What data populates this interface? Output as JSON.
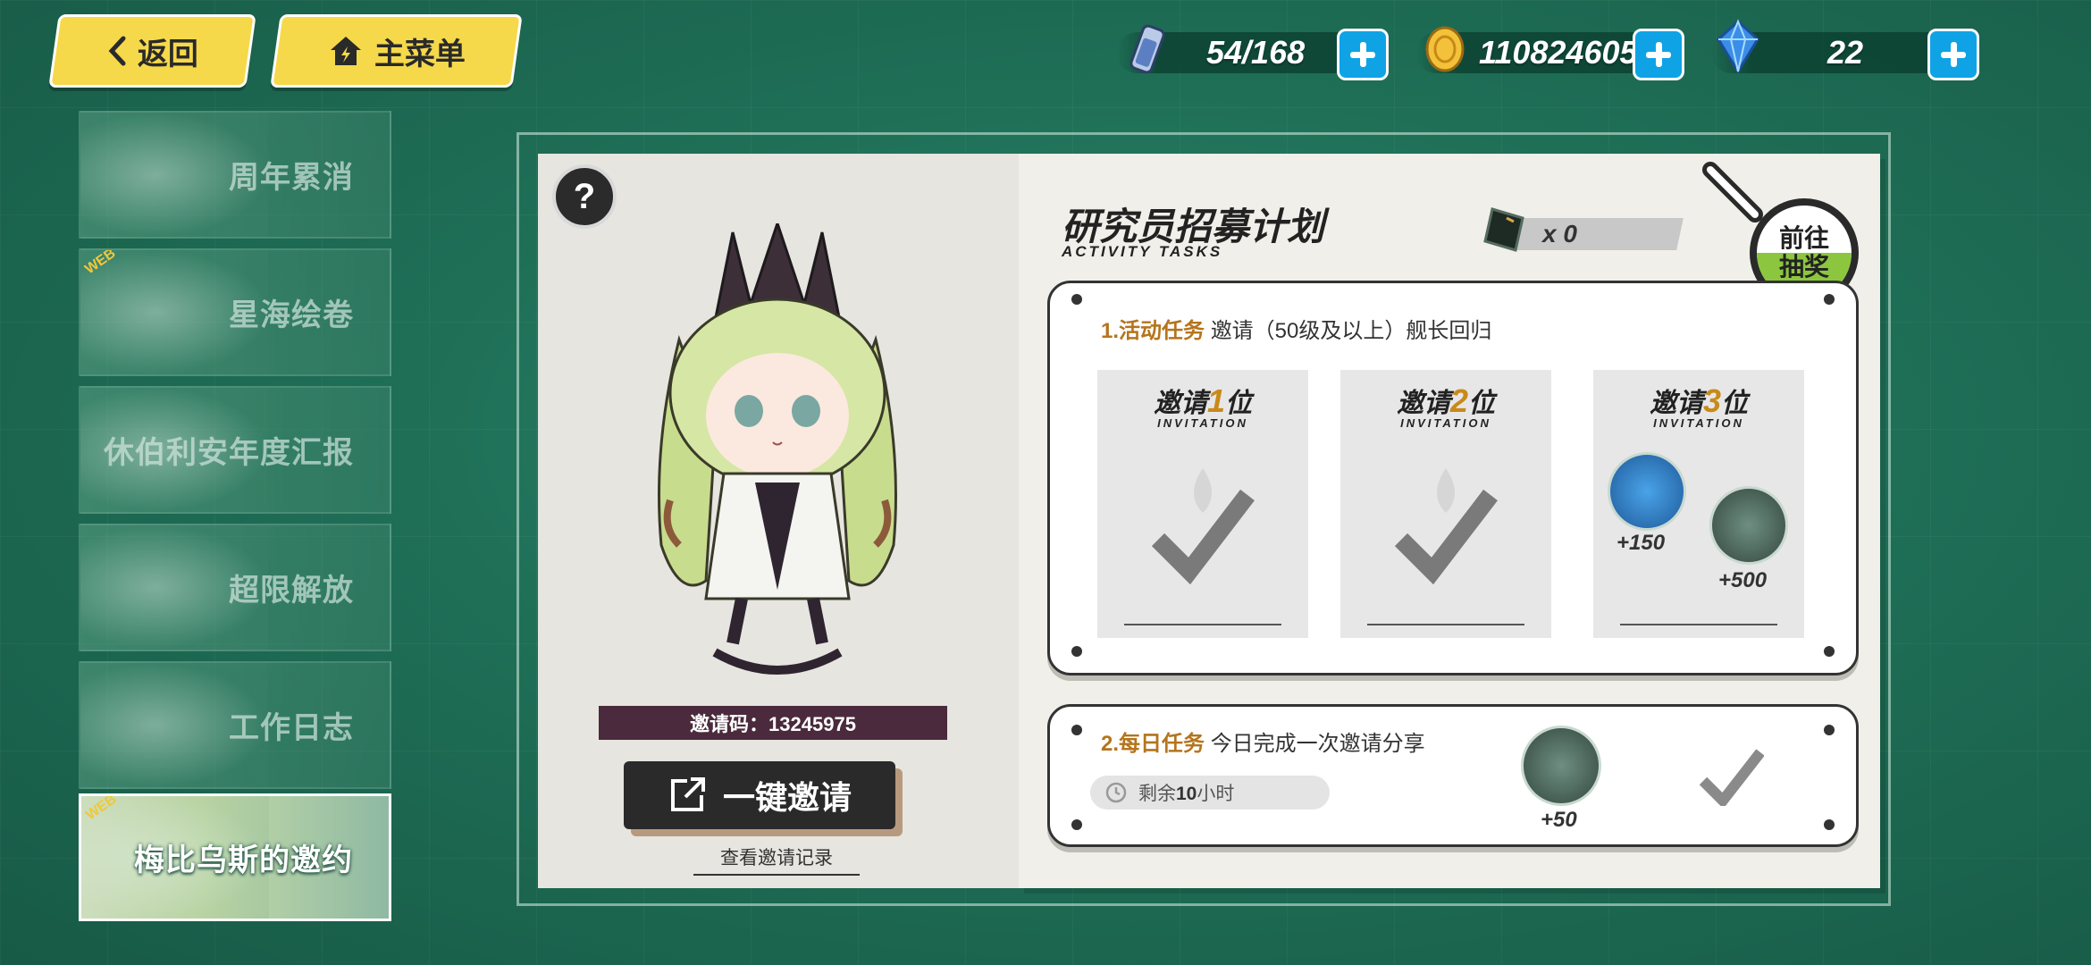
{
  "top_nav": {
    "back_label": "返回",
    "menu_label": "主菜单"
  },
  "currencies": [
    {
      "icon": "stamina-icon",
      "value": "54/168"
    },
    {
      "icon": "gold-coin-icon",
      "value": "110824605"
    },
    {
      "icon": "crystal-icon",
      "value": "22"
    }
  ],
  "sidebar": {
    "items": [
      {
        "label": "周年累消",
        "web": false,
        "active": false
      },
      {
        "label": "星海绘卷",
        "web": true,
        "active": false
      },
      {
        "label": "休伯利安年度汇报",
        "web": false,
        "active": false
      },
      {
        "label": "超限解放",
        "web": false,
        "active": false
      },
      {
        "label": "工作日志",
        "web": false,
        "active": false
      },
      {
        "label": "梅比乌斯的邀约",
        "web": true,
        "active": true
      }
    ],
    "web_tag": "WEB"
  },
  "left_page": {
    "help": "?",
    "invite_code": "邀请码：13245975",
    "share_button": "一键邀请",
    "record_link": "查看邀请记录"
  },
  "right_page": {
    "title": "研究员招募计划",
    "subtitle": "ACTIVITY TASKS",
    "ticket_count": "x 0",
    "goto_button": "前往\n抽奖",
    "goto_line1": "前往",
    "goto_line2": "抽奖"
  },
  "task1": {
    "num": "1.活动任务",
    "desc": "邀请（50级及以上）舰长回归",
    "slots": [
      {
        "pre": "邀请",
        "n": "1",
        "post": "位",
        "sub": "INVITATION",
        "done": true
      },
      {
        "pre": "邀请",
        "n": "2",
        "post": "位",
        "sub": "INVITATION",
        "done": true
      },
      {
        "pre": "邀请",
        "n": "3",
        "post": "位",
        "sub": "INVITATION",
        "done": false
      }
    ],
    "rewards": [
      {
        "icon": "crystal-chest-icon",
        "amount": "+150"
      },
      {
        "icon": "ticket-icon",
        "amount": "+500"
      }
    ]
  },
  "task2": {
    "num": "2.每日任务",
    "desc": "今日完成一次邀请分享",
    "timer_prefix": "剩余",
    "timer_value": "10",
    "timer_suffix": "小时",
    "reward_amount": "+50"
  },
  "colors": {
    "accent_yellow": "#f5d94a",
    "plus_blue": "#0fa3e6",
    "task_orange": "#b5741c",
    "goto_green": "#8cc63f"
  }
}
